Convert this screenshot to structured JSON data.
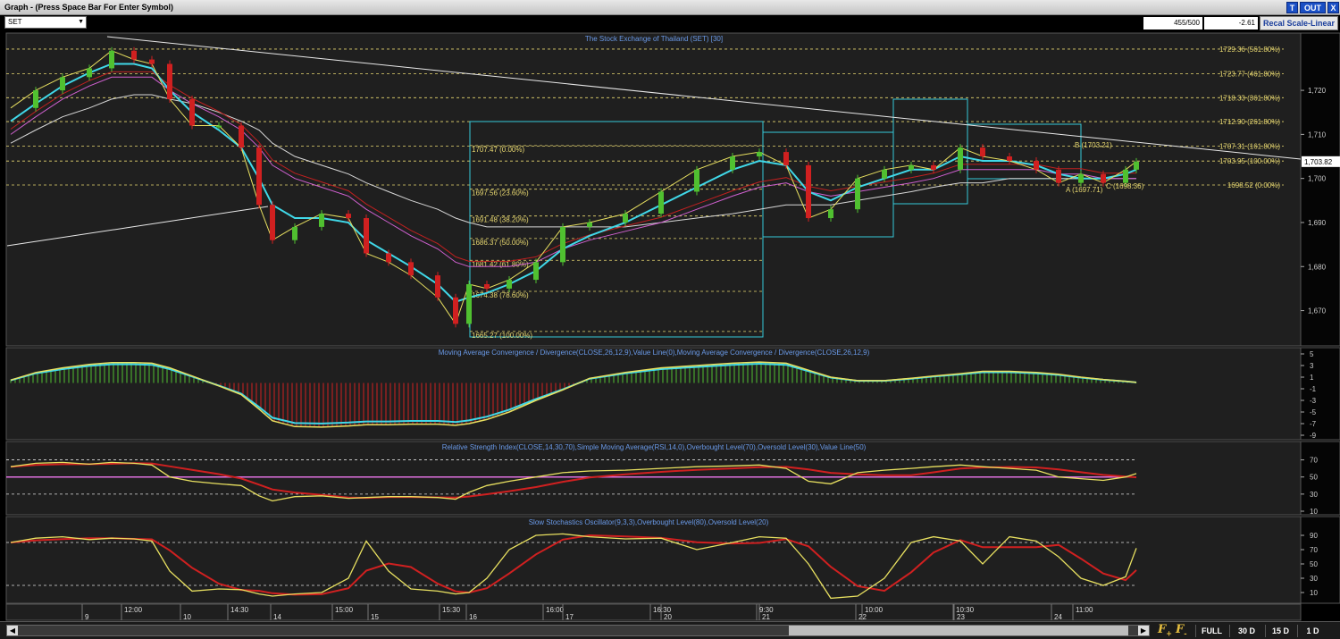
{
  "window": {
    "title": "Graph  - (Press Space Bar For Enter Symbol)",
    "buttons": [
      "T",
      "OUT",
      "X"
    ]
  },
  "toolbar": {
    "symbol": "SET",
    "counter": "455/500",
    "change": "-2.61",
    "recal_label": "Recal Scale-Linear"
  },
  "panels": {
    "price_title": "The Stock Exchange of Thailand (SET) [30]",
    "macd_title": "Moving Average Convergence / Divergence(CLOSE,26,12,9),Value Line(0),Moving Average Convergence / Divergence(CLOSE,26,12,9)",
    "rsi_title": "Relative Strength Index(CLOSE,14,30,70),Simple Moving Average(RSI,14,0),Overbought Level(70),Oversold Level(30),Value Line(50)",
    "stoch_title": "Slow Stochastics Oscillator(9,3,3),Overbought Level(80),Oversold Level(20)"
  },
  "chart_data": {
    "type": "candlestick",
    "title": "The Stock Exchange of Thailand (SET) [30]",
    "y_axis": {
      "ylim": [
        1662,
        1733
      ],
      "ticks": [
        "1,720",
        "1,710",
        "1,700",
        "1,690",
        "1,680",
        "1,670"
      ]
    },
    "last_price": "1,703.82",
    "fib_extension_levels": [
      {
        "label": "1729.36 (561.80%)",
        "value": 1729.36
      },
      {
        "label": "1723.77 (461.80%)",
        "value": 1723.77
      },
      {
        "label": "1718.33 (361.80%)",
        "value": 1718.33
      },
      {
        "label": "1712.90 (261.80%)",
        "value": 1712.9
      },
      {
        "label": "1707.31 (161.80%)",
        "value": 1707.31
      },
      {
        "label": "1703.95 (100.00%)",
        "value": 1703.95
      },
      {
        "label": "1698.52 (0.00%)",
        "value": 1698.52
      }
    ],
    "fib_retracement_levels": [
      {
        "label": "1707.47 (0.00%)",
        "value": 1707.47
      },
      {
        "label": "1697.56 (23.60%)",
        "value": 1697.56
      },
      {
        "label": "1691.48 (38.20%)",
        "value": 1691.48
      },
      {
        "label": "1686.37 (50.00%)",
        "value": 1686.37
      },
      {
        "label": "1681.42 (61.80%)",
        "value": 1681.42
      },
      {
        "label": "1674.38 (78.60%)",
        "value": 1674.38
      },
      {
        "label": "1665.27 (100.00%)",
        "value": 1665.27
      }
    ],
    "annotations": [
      "B (1703.21)",
      "A (1697.71)",
      "C (1698.36)"
    ],
    "x_ticks": [
      {
        "label": "9",
        "pos": 92
      },
      {
        "label": "12:00",
        "pos": 136
      },
      {
        "label": "10",
        "pos": 202
      },
      {
        "label": "14:30",
        "pos": 255
      },
      {
        "label": "14",
        "pos": 303
      },
      {
        "label": "15:00",
        "pos": 372
      },
      {
        "label": "15",
        "pos": 412
      },
      {
        "label": "15:30",
        "pos": 492
      },
      {
        "label": "16",
        "pos": 522
      },
      {
        "label": "16:00",
        "pos": 608
      },
      {
        "label": "17",
        "pos": 630
      },
      {
        "label": "16:30",
        "pos": 728
      },
      {
        "label": "20",
        "pos": 740
      },
      {
        "label": "9:30",
        "pos": 847
      },
      {
        "label": "21",
        "pos": 850
      },
      {
        "label": "22",
        "pos": 958
      },
      {
        "label": "10:00",
        "pos": 965
      },
      {
        "label": "10:30",
        "pos": 1067
      },
      {
        "label": "23",
        "pos": 1068
      },
      {
        "label": "24",
        "pos": 1177
      },
      {
        "label": "11:00",
        "pos": 1201
      }
    ],
    "series": [
      {
        "name": "Close",
        "x": [
          12,
          40,
          70,
          100,
          125,
          150,
          170,
          190,
          215,
          245,
          270,
          290,
          305,
          330,
          360,
          390,
          410,
          435,
          460,
          490,
          510,
          525,
          545,
          570,
          600,
          630,
          660,
          700,
          740,
          780,
          820,
          850,
          880,
          905,
          930,
          960,
          990,
          1020,
          1045,
          1075,
          1100,
          1130,
          1160,
          1185,
          1210,
          1235,
          1260,
          1272
        ],
        "values": [
          1716,
          1720,
          1723,
          1725,
          1729,
          1727,
          1726,
          1718,
          1712,
          1712,
          1707,
          1694,
          1686,
          1689,
          1692,
          1691,
          1683,
          1681,
          1678,
          1673,
          1667,
          1676,
          1675,
          1677,
          1681,
          1689,
          1690,
          1692,
          1697,
          1702,
          1705,
          1706,
          1703,
          1691,
          1693,
          1700,
          1702,
          1703,
          1702,
          1707,
          1705,
          1704,
          1702,
          1699,
          1701,
          1699,
          1702,
          1703.82
        ]
      },
      {
        "name": "MA fast",
        "values": [
          1713,
          1717,
          1721,
          1724,
          1726,
          1726,
          1725,
          1720,
          1715,
          1711,
          1707,
          1700,
          1694,
          1691,
          1691,
          1690,
          1686,
          1683,
          1680,
          1676,
          1672,
          1673,
          1674,
          1676,
          1679,
          1684,
          1687,
          1690,
          1694,
          1698,
          1702,
          1704,
          1703,
          1697,
          1695,
          1698,
          1700,
          1702,
          1702,
          1705,
          1704,
          1704,
          1703,
          1701,
          1700,
          1700,
          1701,
          1702
        ]
      },
      {
        "name": "MA slow",
        "values": [
          1710,
          1714,
          1718,
          1721,
          1723,
          1723,
          1723,
          1720,
          1717,
          1714,
          1711,
          1707,
          1703,
          1700,
          1698,
          1696,
          1693,
          1690,
          1687,
          1684,
          1681,
          1680,
          1680,
          1680,
          1681,
          1684,
          1686,
          1688,
          1690,
          1693,
          1696,
          1698,
          1699,
          1697,
          1696,
          1697,
          1698,
          1699,
          1700,
          1702,
          1702,
          1702,
          1702,
          1701,
          1701,
          1700,
          1700,
          1700
        ]
      },
      {
        "name": "MA long",
        "values": [
          1708,
          1711,
          1714,
          1716,
          1718,
          1719,
          1719,
          1718,
          1717,
          1715,
          1713,
          1711,
          1708,
          1705,
          1703,
          1701,
          1699,
          1697,
          1695,
          1693,
          1691,
          1690,
          1689,
          1689,
          1689,
          1689,
          1689,
          1689,
          1690,
          1691,
          1692,
          1693,
          1694,
          1694,
          1694,
          1695,
          1696,
          1697,
          1698,
          1699,
          1699,
          1700,
          1700,
          1700,
          1700,
          1700,
          1700,
          1700
        ]
      }
    ],
    "macd": {
      "ticks": [
        "5",
        "3",
        "1",
        "-1",
        "-3",
        "-5",
        "-7",
        "-9"
      ],
      "values": [
        0.5,
        1.8,
        2.6,
        3.2,
        3.5,
        3.5,
        3.4,
        2.6,
        1.2,
        -0.5,
        -2,
        -4.5,
        -6.5,
        -7.5,
        -7.6,
        -7.4,
        -7.2,
        -7.2,
        -7.1,
        -7.1,
        -7.3,
        -7,
        -6.3,
        -5,
        -3,
        -1.2,
        0.8,
        1.8,
        2.6,
        3,
        3.4,
        3.6,
        3.4,
        2.2,
        1,
        0.4,
        0.4,
        0.8,
        1.2,
        1.6,
        2,
        2,
        1.8,
        1.5,
        1,
        0.6,
        0.3,
        0.1
      ]
    },
    "rsi": {
      "ticks": [
        "70",
        "50",
        "30",
        "10"
      ],
      "overbought": 70,
      "oversold": 30,
      "values": [
        62,
        66,
        67,
        65,
        67,
        66,
        64,
        50,
        45,
        42,
        40,
        28,
        22,
        27,
        28,
        25,
        26,
        27,
        27,
        26,
        24,
        32,
        40,
        45,
        50,
        55,
        57,
        58,
        60,
        62,
        63,
        64,
        60,
        45,
        42,
        55,
        58,
        60,
        62,
        64,
        62,
        60,
        58,
        50,
        48,
        46,
        50,
        54
      ]
    },
    "stochastic": {
      "ticks": [
        "90",
        "70",
        "50",
        "30",
        "10"
      ],
      "overbought": 80,
      "oversold": 20,
      "values": [
        80,
        86,
        88,
        84,
        86,
        85,
        82,
        40,
        12,
        15,
        14,
        8,
        5,
        8,
        10,
        30,
        82,
        40,
        15,
        12,
        8,
        10,
        30,
        70,
        90,
        92,
        88,
        85,
        86,
        70,
        80,
        88,
        86,
        50,
        2,
        5,
        30,
        80,
        88,
        82,
        50,
        88,
        82,
        60,
        30,
        20,
        32,
        72
      ]
    }
  }
}
